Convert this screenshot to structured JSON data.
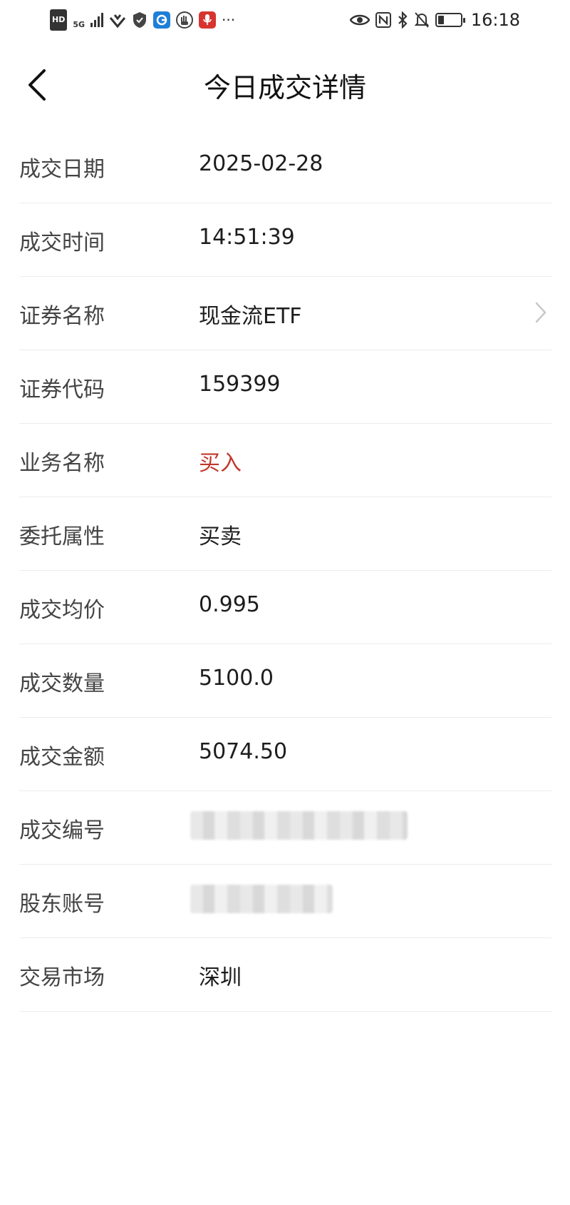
{
  "status_bar": {
    "hd": "HD",
    "network": "5G",
    "more": "···",
    "time": "16:18",
    "icons": [
      "signal-icon",
      "wifi-icon",
      "shield-icon",
      "app-icon",
      "hand-icon",
      "mic-icon",
      "eye-icon",
      "nfc-icon",
      "bluetooth-icon",
      "mute-bell-icon",
      "battery-icon"
    ]
  },
  "header": {
    "title": "今日成交详情",
    "back_icon": "chevron-left-icon"
  },
  "details": [
    {
      "label": "成交日期",
      "value": "2025-02-28"
    },
    {
      "label": "成交时间",
      "value": "14:51:39"
    },
    {
      "label": "证券名称",
      "value": "现金流ETF"
    },
    {
      "label": "证券代码",
      "value": "159399"
    },
    {
      "label": "业务名称",
      "value": "买入"
    },
    {
      "label": "委托属性",
      "value": "买卖"
    },
    {
      "label": "成交均价",
      "value": "0.995"
    },
    {
      "label": "成交数量",
      "value": "5100.0"
    },
    {
      "label": "成交金额",
      "value": "5074.50"
    },
    {
      "label": "成交编号",
      "value": ""
    },
    {
      "label": "股东账号",
      "value": ""
    },
    {
      "label": "交易市场",
      "value": "深圳"
    }
  ],
  "colors": {
    "buy_red": "#c0392b",
    "divider": "#ececec"
  }
}
